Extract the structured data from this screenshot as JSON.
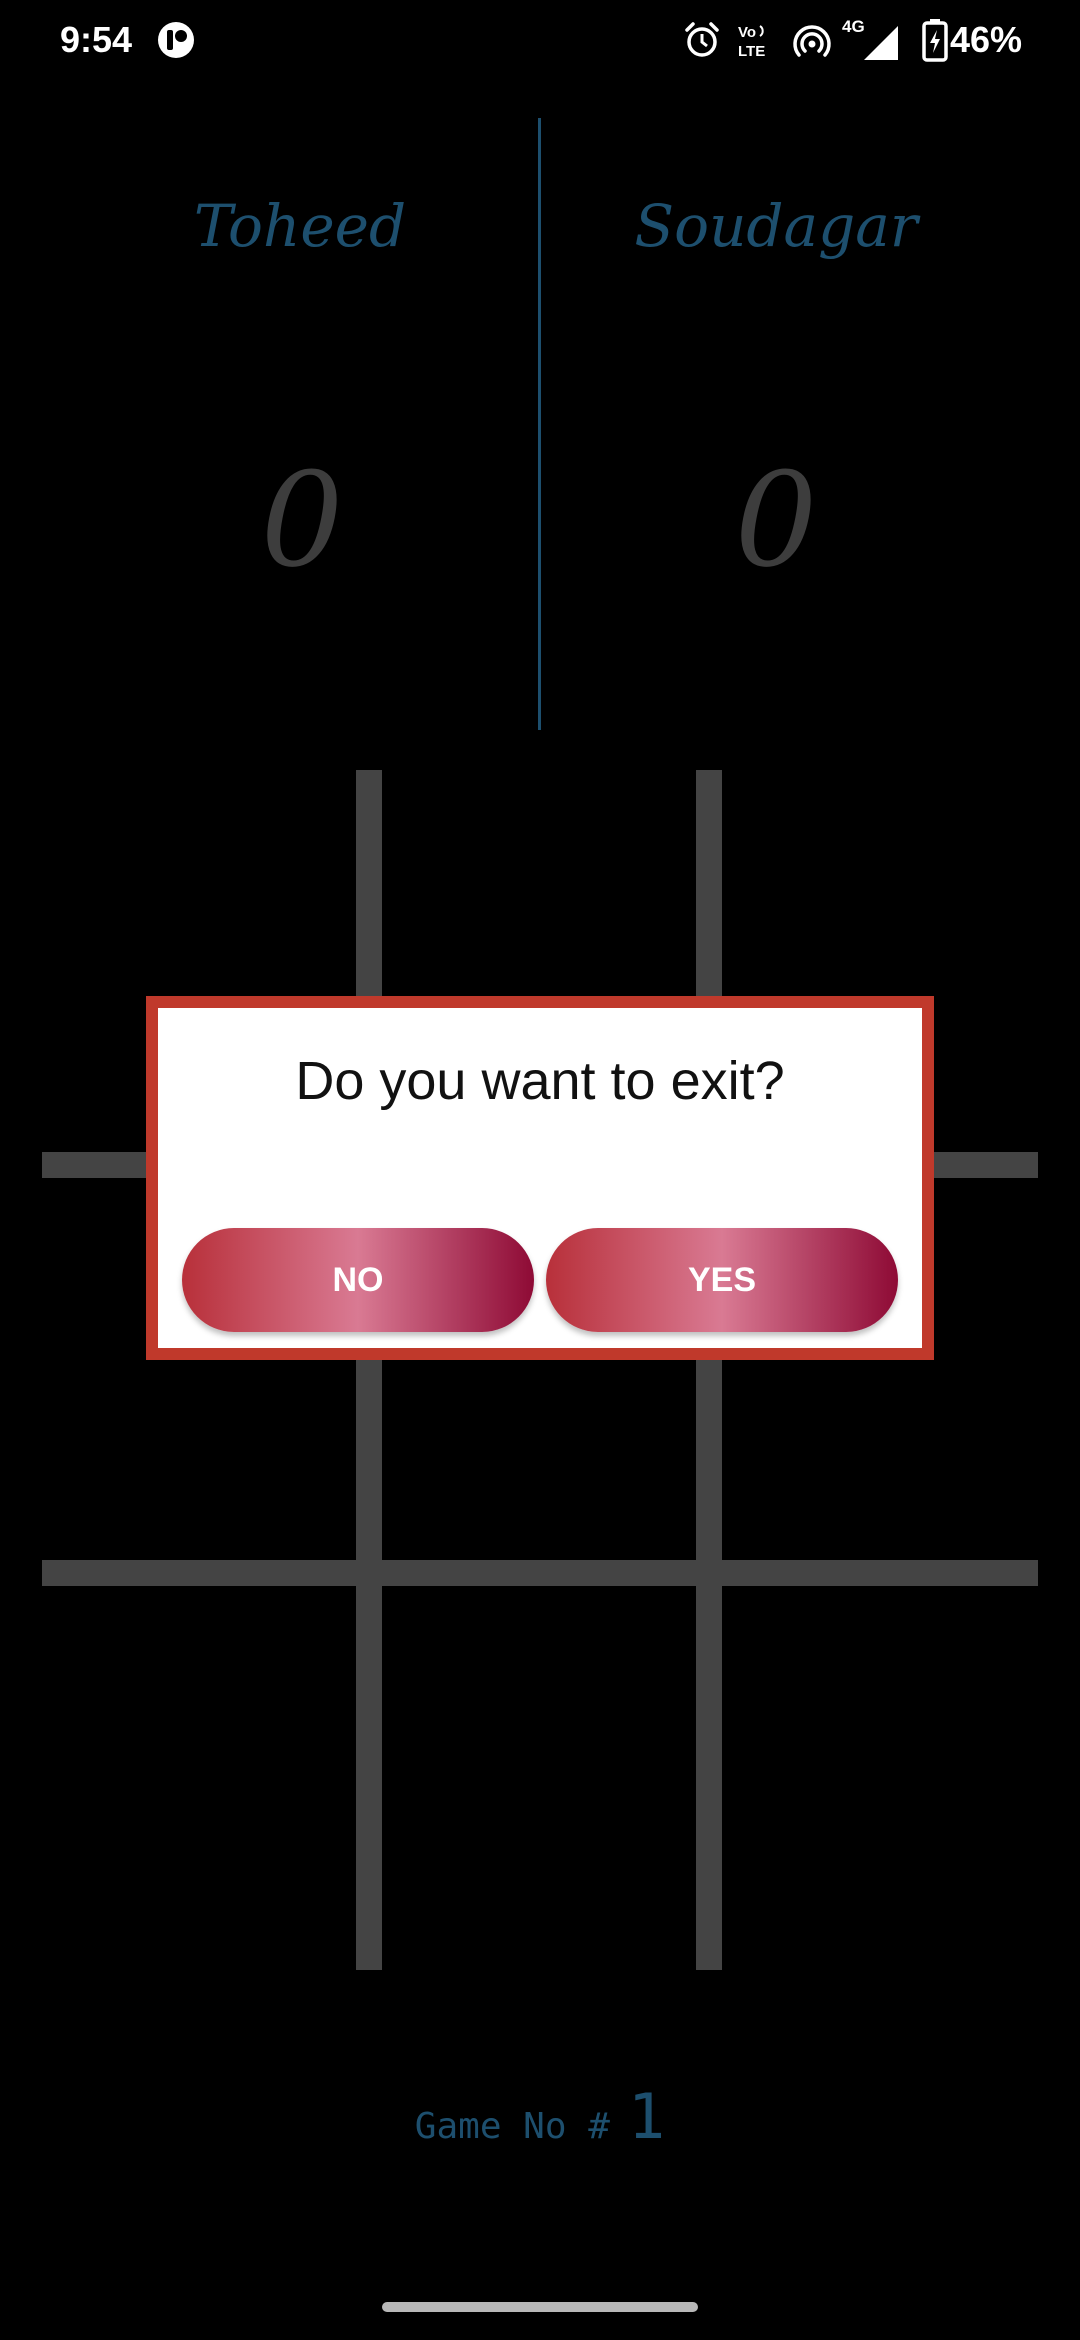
{
  "status_bar": {
    "time": "9:54",
    "battery": "46%",
    "icons": [
      "app-notification-icon",
      "alarm-icon",
      "volte-icon",
      "hotspot-icon",
      "signal-4g-icon",
      "battery-icon"
    ]
  },
  "players": [
    {
      "name": "Toheed",
      "score": "0"
    },
    {
      "name": "Soudagar",
      "score": "0"
    }
  ],
  "dialog": {
    "title": "Do you want to exit?",
    "no_label": "NO",
    "yes_label": "YES"
  },
  "footer": {
    "game_label": "Game No #",
    "game_number": "1"
  },
  "colors": {
    "background": "#000000",
    "accent": "#1d4f6e",
    "grid": "#444444",
    "dialog_border": "#c0392b"
  }
}
